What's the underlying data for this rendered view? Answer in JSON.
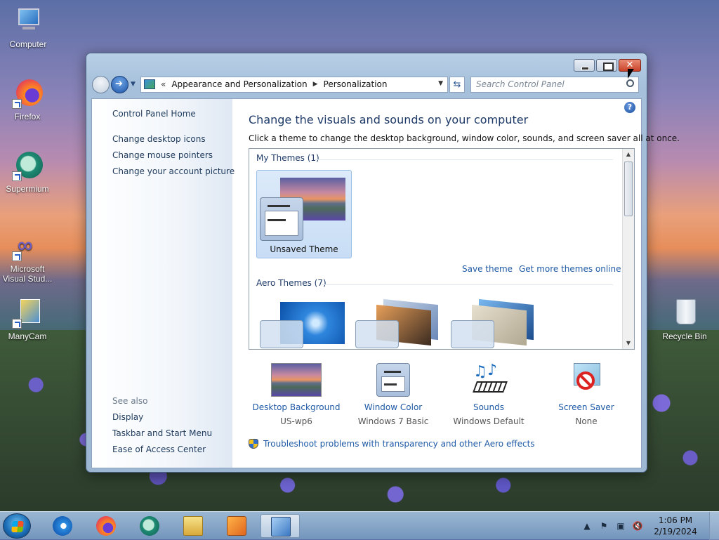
{
  "desktop": {
    "icons": [
      {
        "label": "Computer",
        "icon": "computer-icon"
      },
      {
        "label": "Firefox",
        "icon": "firefox-icon"
      },
      {
        "label": "Supermium",
        "icon": "supermium-icon"
      },
      {
        "label": "Microsoft Visual Stud...",
        "icon": "visual-studio-icon"
      },
      {
        "label": "ManyCam",
        "icon": "manycam-icon"
      },
      {
        "label": "Recycle Bin",
        "icon": "recycle-bin-icon"
      }
    ]
  },
  "window": {
    "address": {
      "chevron": "«",
      "crumb1": "Appearance and Personalization",
      "crumb2": "Personalization",
      "separator": "▶"
    },
    "search_placeholder": "Search Control Panel",
    "close_glyph": "✕",
    "left_pane": {
      "home": "Control Panel Home",
      "links": [
        "Change desktop icons",
        "Change mouse pointers",
        "Change your account picture"
      ],
      "see_also": "See also",
      "see_also_links": [
        "Display",
        "Taskbar and Start Menu",
        "Ease of Access Center"
      ]
    },
    "main": {
      "help": "?",
      "title": "Change the visuals and sounds on your computer",
      "subtitle": "Click a theme to change the desktop background, window color, sounds, and screen saver all at once.",
      "my_themes_header": "My Themes (1)",
      "unsaved_theme": "Unsaved Theme",
      "save_theme": "Save theme",
      "get_more": "Get more themes online",
      "aero_themes_header": "Aero Themes (7)",
      "bottom": [
        {
          "title": "Desktop Background",
          "value": "US-wp6",
          "icon": "desktop-background-icon"
        },
        {
          "title": "Window Color",
          "value": "Windows 7 Basic",
          "icon": "window-color-icon"
        },
        {
          "title": "Sounds",
          "value": "Windows Default",
          "icon": "sounds-icon"
        },
        {
          "title": "Screen Saver",
          "value": "None",
          "icon": "screen-saver-icon"
        }
      ],
      "troubleshoot": "Troubleshoot problems with transparency and other Aero effects"
    }
  },
  "taskbar": {
    "apps": [
      "internet-explorer-icon",
      "firefox-icon",
      "supermium-icon",
      "file-explorer-icon",
      "media-player-icon",
      "control-panel-icon"
    ],
    "tray": {
      "show_hidden": "▲",
      "time": "1:06 PM",
      "date": "2/19/2024"
    }
  },
  "colors": {
    "link": "#1f5aa6",
    "title": "#1e3a68",
    "close_button": "#c9432a"
  }
}
